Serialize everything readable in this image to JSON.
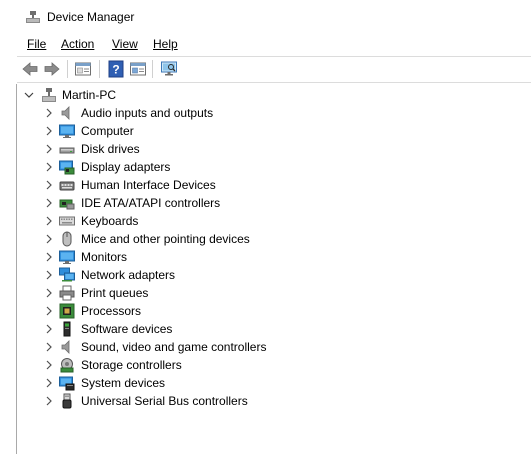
{
  "window": {
    "title": "Device Manager"
  },
  "menu": {
    "file": "File",
    "action": "Action",
    "view": "View",
    "help": "Help"
  },
  "toolbar": {
    "buttons": [
      "back-icon",
      "forward-icon",
      "properties-icon",
      "help-icon",
      "update-driver-icon",
      "scan-hardware-icon"
    ]
  },
  "tree": {
    "root": "Martin-PC",
    "nodes": [
      {
        "label": "Audio inputs and outputs",
        "icon": "speaker-icon"
      },
      {
        "label": "Computer",
        "icon": "monitor-icon"
      },
      {
        "label": "Disk drives",
        "icon": "disk-drive-icon"
      },
      {
        "label": "Display adapters",
        "icon": "display-adapter-icon"
      },
      {
        "label": "Human Interface Devices",
        "icon": "hid-icon"
      },
      {
        "label": "IDE ATA/ATAPI controllers",
        "icon": "ide-controller-icon"
      },
      {
        "label": "Keyboards",
        "icon": "keyboard-icon"
      },
      {
        "label": "Mice and other pointing devices",
        "icon": "mouse-icon"
      },
      {
        "label": "Monitors",
        "icon": "monitor-icon"
      },
      {
        "label": "Network adapters",
        "icon": "network-adapter-icon"
      },
      {
        "label": "Print queues",
        "icon": "printer-icon"
      },
      {
        "label": "Processors",
        "icon": "processor-icon"
      },
      {
        "label": "Software devices",
        "icon": "software-device-icon"
      },
      {
        "label": "Sound, video and game controllers",
        "icon": "speaker-icon"
      },
      {
        "label": "Storage controllers",
        "icon": "storage-controller-icon"
      },
      {
        "label": "System devices",
        "icon": "system-device-icon"
      },
      {
        "label": "Universal Serial Bus controllers",
        "icon": "usb-icon"
      }
    ]
  }
}
